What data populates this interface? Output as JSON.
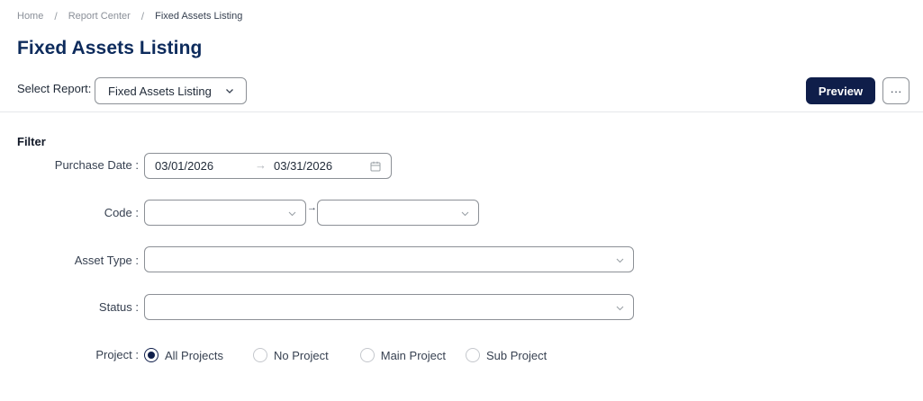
{
  "breadcrumb": {
    "home": "Home",
    "report_center": "Report Center",
    "current": "Fixed Assets Listing",
    "separator": "/"
  },
  "page": {
    "title": "Fixed Assets Listing"
  },
  "report_selector": {
    "label": "Select Report:",
    "selected": "Fixed Assets Listing"
  },
  "actions": {
    "preview_label": "Preview",
    "more_label": "···"
  },
  "filter": {
    "title": "Filter",
    "purchase_date": {
      "label": "Purchase Date :",
      "from": "03/01/2026",
      "arrow": "→",
      "to": "03/31/2026"
    },
    "code": {
      "label": "Code :",
      "from_value": "",
      "to_value": "",
      "arrow": "→"
    },
    "asset_type": {
      "label": "Asset Type :",
      "value": ""
    },
    "status": {
      "label": "Status :",
      "value": ""
    },
    "project": {
      "label": "Project :",
      "options": [
        {
          "label": "All Projects",
          "checked": true
        },
        {
          "label": "No Project",
          "checked": false
        },
        {
          "label": "Main Project",
          "checked": false
        },
        {
          "label": "Sub Project",
          "checked": false
        }
      ]
    }
  },
  "colors": {
    "title": "#0d2b5c",
    "primary_button": "#0f1e4a",
    "border": "#8c9096",
    "divider": "#e5e7eb"
  },
  "icons": {
    "select_chevron": "chevron-down-icon",
    "calendar": "calendar-icon",
    "more": "ellipsis-icon"
  }
}
